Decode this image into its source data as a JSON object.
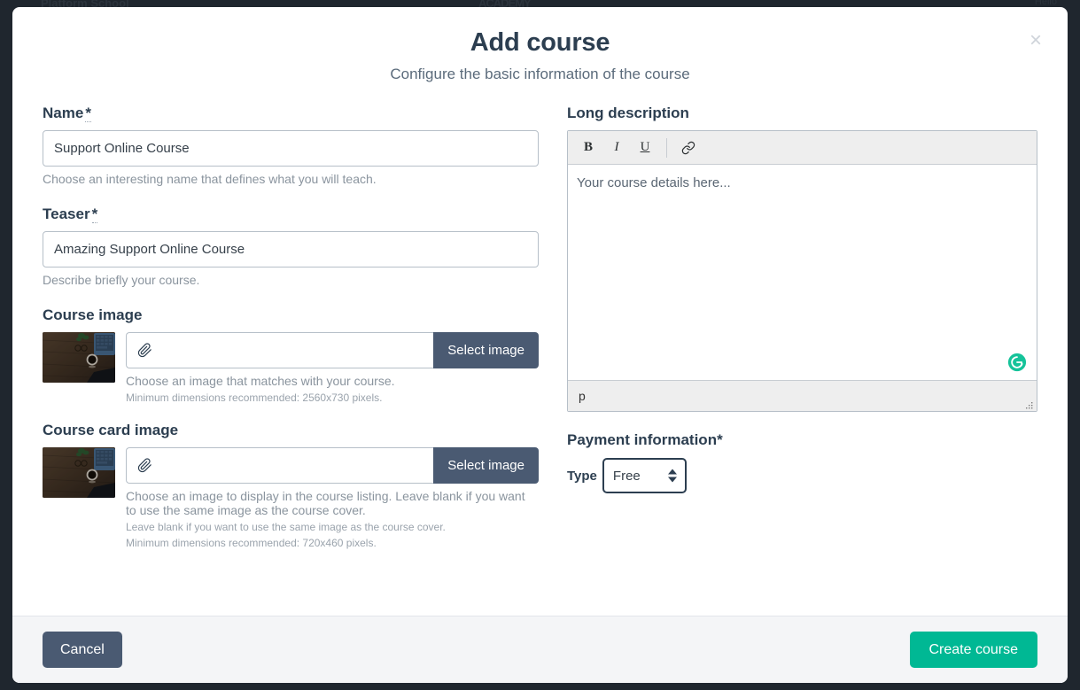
{
  "backdrop": {
    "left_text": "Platform School",
    "center_text": "ACADEMY",
    "right_text": "Hello"
  },
  "modal": {
    "title": "Add course",
    "subtitle": "Configure the basic information of the course",
    "close_label": "×"
  },
  "form": {
    "name": {
      "label": "Name",
      "required_mark": "*",
      "value": "Support Online Course",
      "placeholder": "",
      "help": "Choose an interesting name that defines what you will teach."
    },
    "teaser": {
      "label": "Teaser",
      "required_mark": "*",
      "value": "Amazing Support Online Course",
      "placeholder": "",
      "help": "Describe briefly your course."
    },
    "course_image": {
      "label": "Course image",
      "input_value": "",
      "placeholder": "",
      "button_label": "Select image",
      "help": "Choose an image that matches with your course.",
      "dimensions_note": "Minimum dimensions recommended: 2560x730 pixels."
    },
    "course_card_image": {
      "label": "Course card image",
      "input_value": "",
      "placeholder": "",
      "button_label": "Select image",
      "help": "Choose an image to display in the course listing. Leave blank if you want to use the same image as the course cover.",
      "blank_note": "Leave blank if you want to use the same image as the course cover.",
      "dimensions_note": "Minimum dimensions recommended: 720x460 pixels."
    },
    "long_description": {
      "label": "Long description",
      "toolbar": {
        "bold": "B",
        "italic": "I",
        "underline": "U",
        "link_icon": "link-icon"
      },
      "placeholder": "Your course details here...",
      "content": "Your course details here...",
      "status_path": "p",
      "assistant_icon": "grammarly-icon"
    },
    "payment": {
      "label": "Payment information*",
      "type_label": "Type",
      "type_value": "Free",
      "options": [
        "Free"
      ]
    }
  },
  "footer": {
    "cancel_label": "Cancel",
    "submit_label": "Create course"
  },
  "colors": {
    "accent_green": "#00b894",
    "slate": "#4a5a72",
    "heading": "#2c3e50",
    "backdrop": "#1f262e"
  }
}
